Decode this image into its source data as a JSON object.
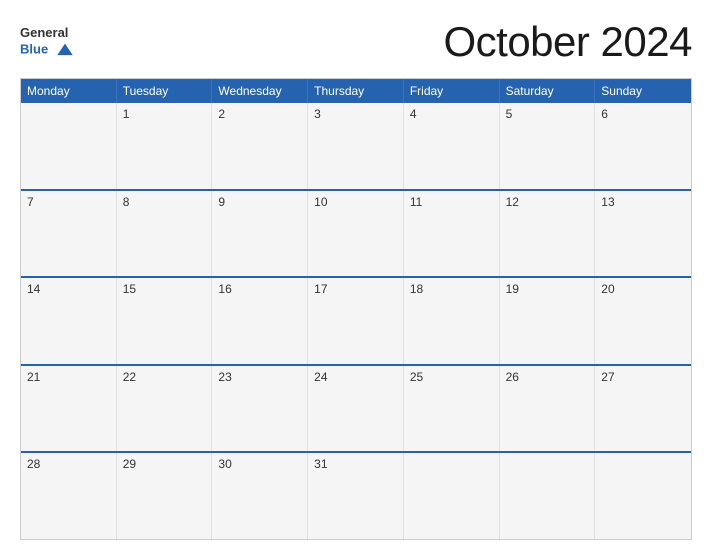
{
  "header": {
    "logo_line1": "General",
    "logo_line2": "Blue",
    "title": "October 2024"
  },
  "calendar": {
    "days_of_week": [
      "Monday",
      "Tuesday",
      "Wednesday",
      "Thursday",
      "Friday",
      "Saturday",
      "Sunday"
    ],
    "rows": [
      [
        {
          "day": "",
          "empty": true
        },
        {
          "day": "1"
        },
        {
          "day": "2"
        },
        {
          "day": "3"
        },
        {
          "day": "4"
        },
        {
          "day": "5"
        },
        {
          "day": "6"
        }
      ],
      [
        {
          "day": "7"
        },
        {
          "day": "8"
        },
        {
          "day": "9"
        },
        {
          "day": "10"
        },
        {
          "day": "11"
        },
        {
          "day": "12"
        },
        {
          "day": "13"
        }
      ],
      [
        {
          "day": "14"
        },
        {
          "day": "15"
        },
        {
          "day": "16"
        },
        {
          "day": "17"
        },
        {
          "day": "18"
        },
        {
          "day": "19"
        },
        {
          "day": "20"
        }
      ],
      [
        {
          "day": "21"
        },
        {
          "day": "22"
        },
        {
          "day": "23"
        },
        {
          "day": "24"
        },
        {
          "day": "25"
        },
        {
          "day": "26"
        },
        {
          "day": "27"
        }
      ],
      [
        {
          "day": "28"
        },
        {
          "day": "29"
        },
        {
          "day": "30"
        },
        {
          "day": "31"
        },
        {
          "day": "",
          "empty": true
        },
        {
          "day": "",
          "empty": true
        },
        {
          "day": "",
          "empty": true
        }
      ]
    ]
  }
}
